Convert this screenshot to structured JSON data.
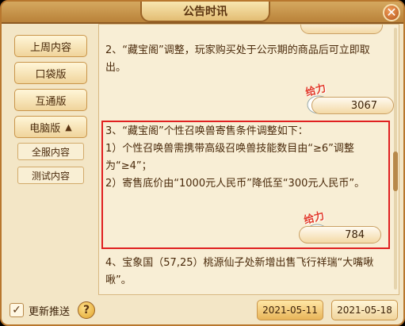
{
  "window": {
    "title": "公告时讯"
  },
  "sidebar": {
    "items": [
      {
        "label": "上周内容"
      },
      {
        "label": "口袋版"
      },
      {
        "label": "互通版"
      },
      {
        "label": "电脑版",
        "expanded": true
      }
    ],
    "sub_items": [
      {
        "label": "全服内容"
      },
      {
        "label": "测试内容"
      }
    ]
  },
  "content": {
    "items": [
      {
        "text": "2、“藏宝阁”调整，玩家购买处于公示期的商品后可立即取出。",
        "likes": "3067"
      },
      {
        "text": "3、“藏宝阁”个性召唤兽寄售条件调整如下：\n1）个性召唤兽需携带高级召唤兽技能数目由“≥6”调整为“≥4”；\n2）寄售底价由“1000元人民币”降低至“300元人民币”。",
        "likes": "784"
      },
      {
        "text": "4、宝象国（57,25）桃源仙子处新增出售飞行祥瑞“大嘴啾啾”。"
      }
    ],
    "like_badge": "给力"
  },
  "footer": {
    "auto_push_label": "更新推送",
    "auto_push_checked": true,
    "dates": [
      "2021-05-11",
      "2021-05-18"
    ]
  },
  "colors": {
    "accent": "#b8772e",
    "highlight": "#e02020",
    "badge": "#e23c2b"
  }
}
